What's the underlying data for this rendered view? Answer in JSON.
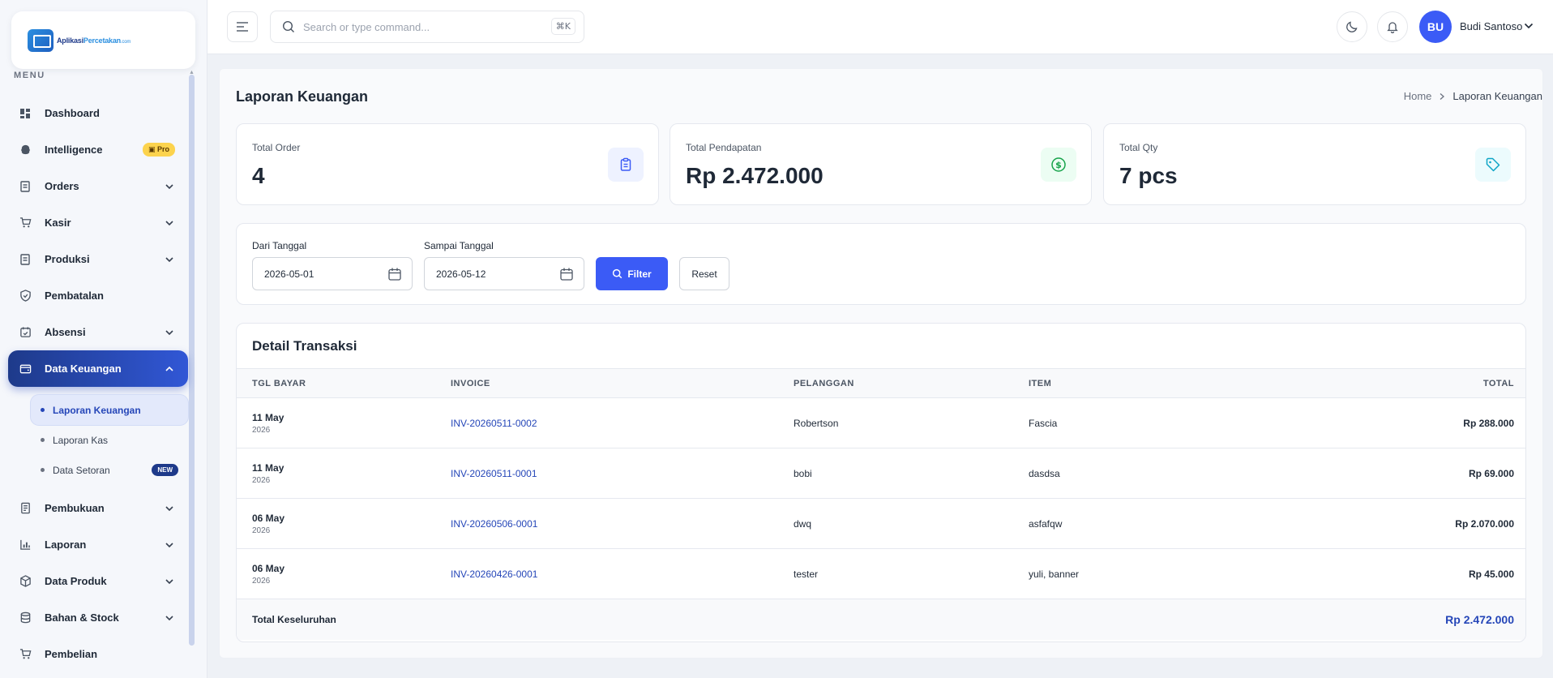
{
  "brand": {
    "name_part1": "Aplikasi",
    "name_part2": "Percetakan",
    "name_suffix": ".com"
  },
  "sidebar": {
    "menu_label": "MENU",
    "items": [
      {
        "label": "Dashboard",
        "icon": "dashboard-icon"
      },
      {
        "label": "Intelligence",
        "icon": "brain-icon",
        "badge": "Pro"
      },
      {
        "label": "Orders",
        "icon": "document-icon"
      },
      {
        "label": "Kasir",
        "icon": "cart-icon"
      },
      {
        "label": "Produksi",
        "icon": "document-icon"
      },
      {
        "label": "Pembatalan",
        "icon": "shield-check-icon"
      },
      {
        "label": "Absensi",
        "icon": "calendar-check-icon"
      },
      {
        "label": "Data Keuangan",
        "icon": "wallet-icon"
      },
      {
        "label": "Pembukuan",
        "icon": "book-icon"
      },
      {
        "label": "Laporan",
        "icon": "bar-chart-icon"
      },
      {
        "label": "Data Produk",
        "icon": "box-icon"
      },
      {
        "label": "Bahan & Stock",
        "icon": "database-icon"
      },
      {
        "label": "Pembelian",
        "icon": "cart-icon"
      }
    ],
    "sub_items": [
      {
        "label": "Laporan Keuangan"
      },
      {
        "label": "Laporan Kas"
      },
      {
        "label": "Data Setoran",
        "badge": "NEW"
      }
    ]
  },
  "header": {
    "search_placeholder": "Search or type command...",
    "search_shortcut": "⌘K",
    "avatar_initials": "BU",
    "user_name": "Budi Santoso"
  },
  "page": {
    "title": "Laporan Keuangan",
    "breadcrumb": {
      "home": "Home",
      "current": "Laporan Keuangan"
    }
  },
  "stats": [
    {
      "label": "Total Order",
      "value": "4",
      "icon": "clipboard-icon",
      "color": "#3b5bf6",
      "bg": "#eef2ff"
    },
    {
      "label": "Total Pendapatan",
      "value": "Rp 2.472.000",
      "icon": "dollar-circle-icon",
      "color": "#16a34a",
      "bg": "#ecfdf3"
    },
    {
      "label": "Total Qty",
      "value": "7 pcs",
      "icon": "tag-icon",
      "color": "#0ea5c6",
      "bg": "#ecfbfd"
    }
  ],
  "filter": {
    "from_label": "Dari Tanggal",
    "from_value": "2026-05-01",
    "to_label": "Sampai Tanggal",
    "to_value": "2026-05-12",
    "filter_button": "Filter",
    "reset_button": "Reset"
  },
  "transactions": {
    "title": "Detail Transaksi",
    "columns": [
      "TGL BAYAR",
      "INVOICE",
      "PELANGGAN",
      "ITEM",
      "TOTAL"
    ],
    "rows": [
      {
        "day": "11 May",
        "year": "2026",
        "invoice": "INV-20260511-0002",
        "customer": "Robertson",
        "item": "Fascia",
        "total": "Rp 288.000"
      },
      {
        "day": "11 May",
        "year": "2026",
        "invoice": "INV-20260511-0001",
        "customer": "bobi",
        "item": "dasdsa",
        "total": "Rp 69.000"
      },
      {
        "day": "06 May",
        "year": "2026",
        "invoice": "INV-20260506-0001",
        "customer": "dwq",
        "item": "asfafqw",
        "total": "Rp 2.070.000"
      },
      {
        "day": "06 May",
        "year": "2026",
        "invoice": "INV-20260426-0001",
        "customer": "tester",
        "item": "yuli, banner",
        "total": "Rp 45.000"
      }
    ],
    "footer_label": "Total Keseluruhan",
    "footer_total": "Rp 2.472.000"
  }
}
